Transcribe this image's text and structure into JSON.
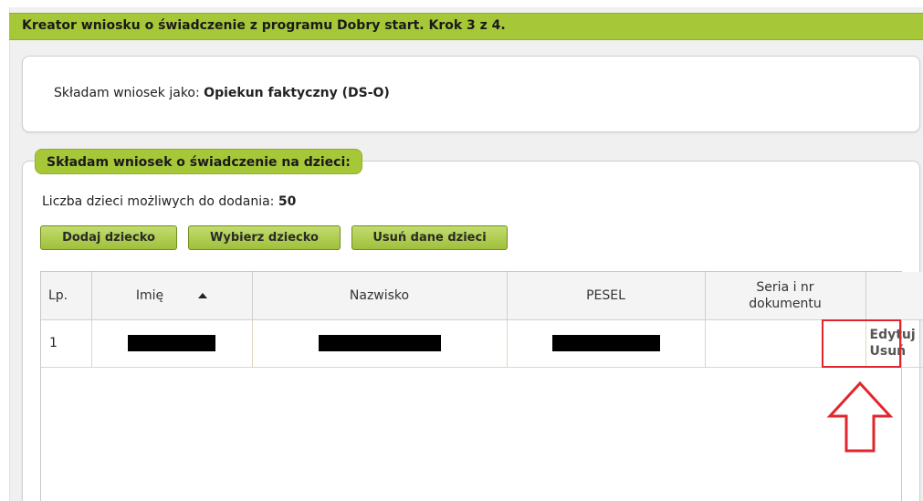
{
  "header": {
    "title": "Kreator wniosku o świadczenie z programu Dobry start. Krok 3 z 4."
  },
  "applicant": {
    "label": "Składam wniosek jako:",
    "value": "Opiekun faktyczny (DS-O)"
  },
  "children_section": {
    "legend": "Składam wniosek o świadczenie na dzieci:",
    "count_label": "Liczba dzieci możliwych do dodania:",
    "count_value": "50",
    "buttons": {
      "add": "Dodaj dziecko",
      "choose": "Wybierz dziecko",
      "remove_all": "Usuń dane dzieci"
    },
    "table": {
      "columns": {
        "lp": "Lp.",
        "first_name": "Imię",
        "last_name": "Nazwisko",
        "pesel": "PESEL",
        "document_line1": "Seria i nr",
        "document_line2": "dokumentu",
        "actions": ""
      },
      "rows": [
        {
          "lp": "1",
          "first_name": "",
          "last_name": "",
          "pesel": "",
          "document": "",
          "edit": "Edytuj",
          "delete": "Usuń"
        }
      ]
    }
  },
  "colors": {
    "accent_green": "#a6c838",
    "highlight_red": "#e0262c"
  },
  "icons": {
    "sort": "sort-ascending-icon",
    "arrow": "up-arrow-outline-icon"
  }
}
